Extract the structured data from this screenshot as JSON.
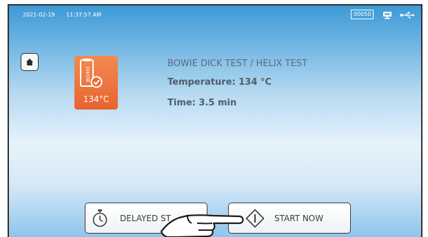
{
  "status_bar": {
    "date": "2021-02-19",
    "time": "11:37:57 AM",
    "counter": "00050",
    "icons": [
      "network-icon",
      "usb-icon"
    ]
  },
  "home": {
    "icon": "home-icon"
  },
  "program": {
    "icon": "bowie-dick-helix-program-icon",
    "icon_text": "BD/HX",
    "icon_temp": "134°C",
    "icon_color": "#e96a35",
    "title": "BOWIE DICK TEST / HELIX TEST",
    "temperature": "Temperature: 134 °C",
    "time": "Time: 3.5 min"
  },
  "buttons": {
    "delayed_label": "DELAYED ST",
    "delayed_icon": "stopwatch-icon",
    "start_label": "START NOW",
    "start_icon": "start-diamond-icon"
  },
  "overlay": {
    "icon": "pointing-hand-icon"
  }
}
